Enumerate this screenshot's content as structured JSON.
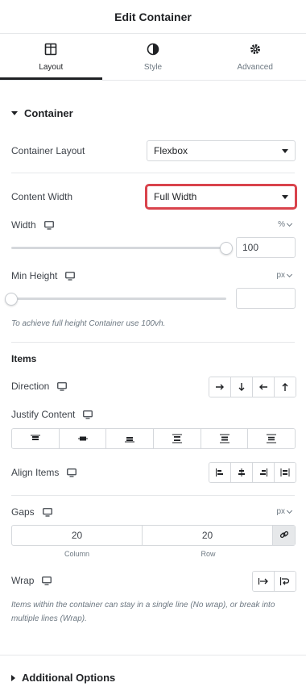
{
  "header": {
    "title": "Edit Container"
  },
  "tabs": [
    {
      "label": "Layout",
      "icon": "layout-icon",
      "active": true
    },
    {
      "label": "Style",
      "icon": "contrast-icon",
      "active": false
    },
    {
      "label": "Advanced",
      "icon": "gear-icon",
      "active": false
    }
  ],
  "section": {
    "title": "Container"
  },
  "container_layout": {
    "label": "Container Layout",
    "value": "Flexbox"
  },
  "content_width": {
    "label": "Content Width",
    "value": "Full Width",
    "highlight_color": "#d9434c"
  },
  "width": {
    "label": "Width",
    "unit": "%",
    "value": "100",
    "fraction": 1.0
  },
  "min_height": {
    "label": "Min Height",
    "unit": "px",
    "value": "",
    "fraction": 0.0
  },
  "min_height_hint": "To achieve full height Container use 100vh.",
  "items": {
    "title": "Items",
    "direction_label": "Direction",
    "justify_label": "Justify Content",
    "align_label": "Align Items"
  },
  "gaps": {
    "label": "Gaps",
    "unit": "px",
    "column_value": "20",
    "row_value": "20",
    "column_caption": "Column",
    "row_caption": "Row"
  },
  "wrap": {
    "label": "Wrap"
  },
  "wrap_hint": "Items within the container can stay in a single line (No wrap), or break into multiple lines (Wrap).",
  "additional": {
    "title": "Additional Options"
  }
}
